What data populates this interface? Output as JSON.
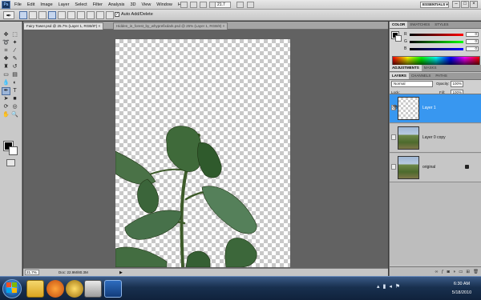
{
  "app": {
    "logo_text": "Ps",
    "menu": [
      "File",
      "Edit",
      "Image",
      "Layer",
      "Select",
      "Filter",
      "Analysis",
      "3D",
      "View",
      "Window",
      "Help"
    ],
    "zoom_dropdown": "21.7",
    "workspace": "ESSENTIALS ▾",
    "window_controls": [
      "–",
      "□",
      "×"
    ]
  },
  "options_bar": {
    "auto_add_delete_label": "Auto Add/Delete",
    "auto_add_delete_checked": true
  },
  "documents": {
    "tabs": [
      {
        "title": "Fairy Tower.psd @ 25.7% (Layer 1, RGB/8*) ×",
        "active": true
      },
      {
        "title": "Hidden_in_forest_by_whyprefixdark.psd @ 25% (Layer 1, RGB/8) ×",
        "active": false
      }
    ]
  },
  "status": {
    "zoom": "21.7%",
    "doc_info": "Doc: 22.9M/80.3M",
    "arrow": "▶"
  },
  "panels": {
    "color": {
      "tabs": [
        "COLOR",
        "SWATCHES",
        "STYLES"
      ],
      "active_tab": "COLOR",
      "fg_color": "#000000",
      "bg_color": "#ffffff",
      "channels": [
        {
          "label": "R",
          "value": "0",
          "colors": [
            "#000000",
            "#ff0000"
          ]
        },
        {
          "label": "G",
          "value": "0",
          "colors": [
            "#000000",
            "#00ff00"
          ]
        },
        {
          "label": "B",
          "value": "0",
          "colors": [
            "#000000",
            "#0000ff"
          ]
        }
      ]
    },
    "adjustments": {
      "tabs": [
        "ADJUSTMENTS",
        "MASKS"
      ],
      "active_tab": "ADJUSTMENTS"
    },
    "layers": {
      "tabs": [
        "LAYERS",
        "CHANNELS",
        "PATHS"
      ],
      "active_tab": "LAYERS",
      "blend_mode": "Normal",
      "opacity_label": "Opacity:",
      "opacity": "100%",
      "lock_label": "Lock:",
      "fill_label": "Fill:",
      "fill": "100%",
      "items": [
        {
          "name": "Layer 1",
          "selected": true,
          "visible": true,
          "thumb": "checker",
          "locked": false
        },
        {
          "name": "Layer 0 copy",
          "selected": false,
          "visible": false,
          "thumb": "photo",
          "locked": false
        },
        {
          "name": "original",
          "selected": false,
          "visible": false,
          "thumb": "photo",
          "locked": true
        }
      ],
      "footer_icons": [
        "link-icon",
        "fx-icon",
        "mask-icon",
        "adjustment-icon",
        "folder-icon",
        "new-layer-icon",
        "trash-icon"
      ]
    }
  },
  "taskbar": {
    "clock_time": "6:30 AM",
    "clock_date": "5/18/2010"
  }
}
